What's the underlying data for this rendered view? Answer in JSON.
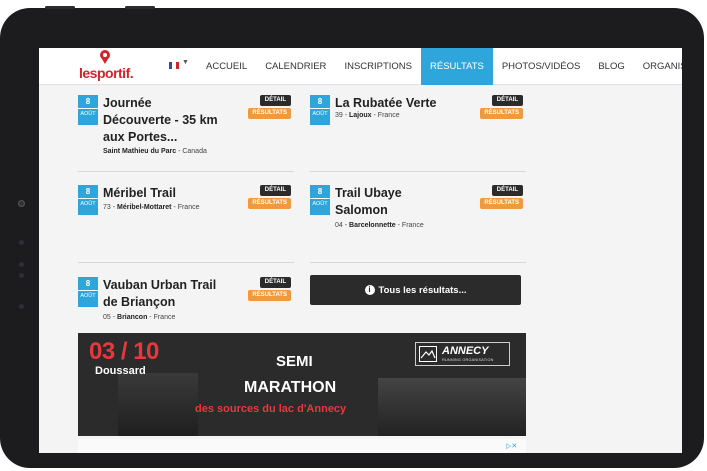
{
  "header": {
    "logo_text": "lesportif.",
    "nav": [
      "ACCUEIL",
      "CALENDRIER",
      "INSCRIPTIONS",
      "RÉSULTATS",
      "PHOTOS/VIDÉOS",
      "BLOG",
      "ORGANISATEU"
    ],
    "active_nav": "RÉSULTATS",
    "language_flag": "flag-fr-icon"
  },
  "events": [
    {
      "day": "8",
      "month": "AOÛT",
      "title": "Journée Découverte - 35 km aux Portes...",
      "title_lines": [
        "Journée",
        "Découverte - 35 km",
        "aux Portes..."
      ],
      "loc_prefix": "",
      "loc_city": "Saint Mathieu du Parc",
      "loc_country": " - Canada",
      "detail": "DÉTAIL",
      "results": "RÉSULTATS"
    },
    {
      "day": "8",
      "month": "AOÛT",
      "title": "La Rubatée Verte",
      "title_lines": [
        "La Rubatée Verte"
      ],
      "loc_prefix": "39 - ",
      "loc_city": "Lajoux",
      "loc_country": " - France",
      "detail": "DÉTAIL",
      "results": "RÉSULTATS"
    },
    {
      "day": "8",
      "month": "AOÛT",
      "title": "Méribel Trail",
      "title_lines": [
        "Méribel Trail"
      ],
      "loc_prefix": "73 - ",
      "loc_city": "Méribel-Mottaret",
      "loc_country": " - France",
      "detail": "DÉTAIL",
      "results": "RÉSULTATS"
    },
    {
      "day": "8",
      "month": "AOÛT",
      "title": "Trail Ubaye Salomon",
      "title_lines": [
        "Trail Ubaye",
        "Salomon"
      ],
      "loc_prefix": "04 - ",
      "loc_city": "Barcelonnette",
      "loc_country": " - France",
      "detail": "DÉTAIL",
      "results": "RÉSULTATS"
    },
    {
      "day": "8",
      "month": "AOÛT",
      "title": "Vauban Urban Trail de Briançon",
      "title_lines": [
        "Vauban Urban Trail",
        "de Briançon"
      ],
      "loc_prefix": "05 - ",
      "loc_city": "Briancon",
      "loc_country": " - France",
      "detail": "DÉTAIL",
      "results": "RÉSULTATS"
    }
  ],
  "all_results_label": "Tous les résultats...",
  "banner": {
    "date": "03 / 10",
    "place": "Doussard",
    "line1": "SEMI",
    "line2": "MARATHON",
    "line3": "des sources du lac d'Annecy",
    "org_name": "ANNECY",
    "org_sub": "RUNNING ORGANISATION"
  },
  "ad_icon": "▷✕",
  "colors": {
    "accent": "#2fa6db",
    "results": "#f09a3e",
    "brand": "#d4232a",
    "dark": "#2b2b2b"
  }
}
